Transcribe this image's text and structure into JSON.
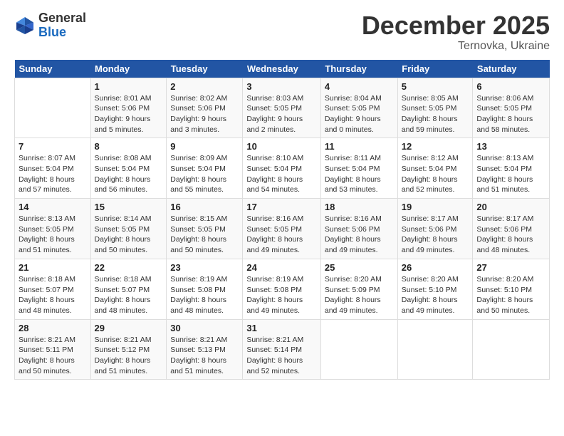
{
  "logo": {
    "general": "General",
    "blue": "Blue"
  },
  "header": {
    "month": "December 2025",
    "location": "Ternovka, Ukraine"
  },
  "days_of_week": [
    "Sunday",
    "Monday",
    "Tuesday",
    "Wednesday",
    "Thursday",
    "Friday",
    "Saturday"
  ],
  "weeks": [
    [
      {
        "day": "",
        "info": ""
      },
      {
        "day": "1",
        "info": "Sunrise: 8:01 AM\nSunset: 5:06 PM\nDaylight: 9 hours\nand 5 minutes."
      },
      {
        "day": "2",
        "info": "Sunrise: 8:02 AM\nSunset: 5:06 PM\nDaylight: 9 hours\nand 3 minutes."
      },
      {
        "day": "3",
        "info": "Sunrise: 8:03 AM\nSunset: 5:05 PM\nDaylight: 9 hours\nand 2 minutes."
      },
      {
        "day": "4",
        "info": "Sunrise: 8:04 AM\nSunset: 5:05 PM\nDaylight: 9 hours\nand 0 minutes."
      },
      {
        "day": "5",
        "info": "Sunrise: 8:05 AM\nSunset: 5:05 PM\nDaylight: 8 hours\nand 59 minutes."
      },
      {
        "day": "6",
        "info": "Sunrise: 8:06 AM\nSunset: 5:05 PM\nDaylight: 8 hours\nand 58 minutes."
      }
    ],
    [
      {
        "day": "7",
        "info": "Sunrise: 8:07 AM\nSunset: 5:04 PM\nDaylight: 8 hours\nand 57 minutes."
      },
      {
        "day": "8",
        "info": "Sunrise: 8:08 AM\nSunset: 5:04 PM\nDaylight: 8 hours\nand 56 minutes."
      },
      {
        "day": "9",
        "info": "Sunrise: 8:09 AM\nSunset: 5:04 PM\nDaylight: 8 hours\nand 55 minutes."
      },
      {
        "day": "10",
        "info": "Sunrise: 8:10 AM\nSunset: 5:04 PM\nDaylight: 8 hours\nand 54 minutes."
      },
      {
        "day": "11",
        "info": "Sunrise: 8:11 AM\nSunset: 5:04 PM\nDaylight: 8 hours\nand 53 minutes."
      },
      {
        "day": "12",
        "info": "Sunrise: 8:12 AM\nSunset: 5:04 PM\nDaylight: 8 hours\nand 52 minutes."
      },
      {
        "day": "13",
        "info": "Sunrise: 8:13 AM\nSunset: 5:04 PM\nDaylight: 8 hours\nand 51 minutes."
      }
    ],
    [
      {
        "day": "14",
        "info": "Sunrise: 8:13 AM\nSunset: 5:05 PM\nDaylight: 8 hours\nand 51 minutes."
      },
      {
        "day": "15",
        "info": "Sunrise: 8:14 AM\nSunset: 5:05 PM\nDaylight: 8 hours\nand 50 minutes."
      },
      {
        "day": "16",
        "info": "Sunrise: 8:15 AM\nSunset: 5:05 PM\nDaylight: 8 hours\nand 50 minutes."
      },
      {
        "day": "17",
        "info": "Sunrise: 8:16 AM\nSunset: 5:05 PM\nDaylight: 8 hours\nand 49 minutes."
      },
      {
        "day": "18",
        "info": "Sunrise: 8:16 AM\nSunset: 5:06 PM\nDaylight: 8 hours\nand 49 minutes."
      },
      {
        "day": "19",
        "info": "Sunrise: 8:17 AM\nSunset: 5:06 PM\nDaylight: 8 hours\nand 49 minutes."
      },
      {
        "day": "20",
        "info": "Sunrise: 8:17 AM\nSunset: 5:06 PM\nDaylight: 8 hours\nand 48 minutes."
      }
    ],
    [
      {
        "day": "21",
        "info": "Sunrise: 8:18 AM\nSunset: 5:07 PM\nDaylight: 8 hours\nand 48 minutes."
      },
      {
        "day": "22",
        "info": "Sunrise: 8:18 AM\nSunset: 5:07 PM\nDaylight: 8 hours\nand 48 minutes."
      },
      {
        "day": "23",
        "info": "Sunrise: 8:19 AM\nSunset: 5:08 PM\nDaylight: 8 hours\nand 48 minutes."
      },
      {
        "day": "24",
        "info": "Sunrise: 8:19 AM\nSunset: 5:08 PM\nDaylight: 8 hours\nand 49 minutes."
      },
      {
        "day": "25",
        "info": "Sunrise: 8:20 AM\nSunset: 5:09 PM\nDaylight: 8 hours\nand 49 minutes."
      },
      {
        "day": "26",
        "info": "Sunrise: 8:20 AM\nSunset: 5:10 PM\nDaylight: 8 hours\nand 49 minutes."
      },
      {
        "day": "27",
        "info": "Sunrise: 8:20 AM\nSunset: 5:10 PM\nDaylight: 8 hours\nand 50 minutes."
      }
    ],
    [
      {
        "day": "28",
        "info": "Sunrise: 8:21 AM\nSunset: 5:11 PM\nDaylight: 8 hours\nand 50 minutes."
      },
      {
        "day": "29",
        "info": "Sunrise: 8:21 AM\nSunset: 5:12 PM\nDaylight: 8 hours\nand 51 minutes."
      },
      {
        "day": "30",
        "info": "Sunrise: 8:21 AM\nSunset: 5:13 PM\nDaylight: 8 hours\nand 51 minutes."
      },
      {
        "day": "31",
        "info": "Sunrise: 8:21 AM\nSunset: 5:14 PM\nDaylight: 8 hours\nand 52 minutes."
      },
      {
        "day": "",
        "info": ""
      },
      {
        "day": "",
        "info": ""
      },
      {
        "day": "",
        "info": ""
      }
    ]
  ]
}
